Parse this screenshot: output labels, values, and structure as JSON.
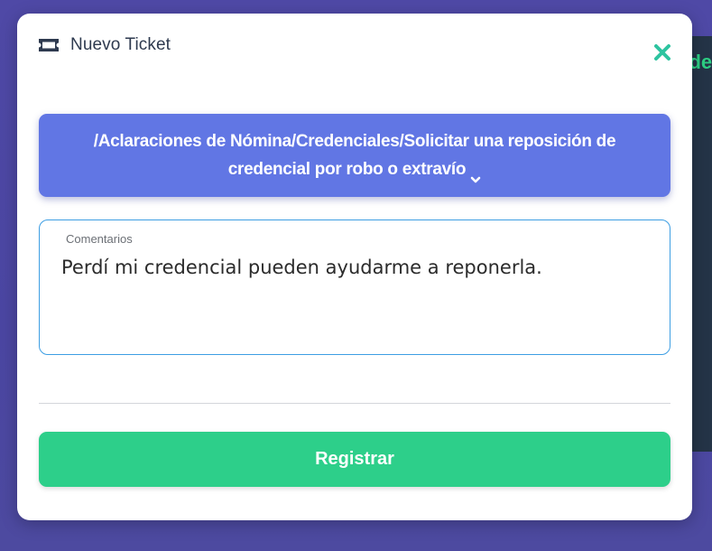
{
  "background": {
    "panel_partial_text": "nde"
  },
  "modal": {
    "title": "Nuevo Ticket",
    "title_icon": "ticket-icon",
    "close_icon": "close-icon",
    "category": {
      "label": "/Aclaraciones de Nómina/Credenciales/Solicitar una reposición de credencial por robo o extravío",
      "icon": "chevron-down-icon"
    },
    "comments": {
      "label": "Comentarios",
      "value": "Perdí mi credencial pueden ayudarme a reponerla."
    },
    "submit_label": "Registrar"
  },
  "colors": {
    "accent_blue": "#6176e4",
    "accent_green": "#2dcf8a",
    "close_teal": "#2ec4a0",
    "input_border": "#3d9ee3",
    "backdrop": "#4f49a6"
  }
}
